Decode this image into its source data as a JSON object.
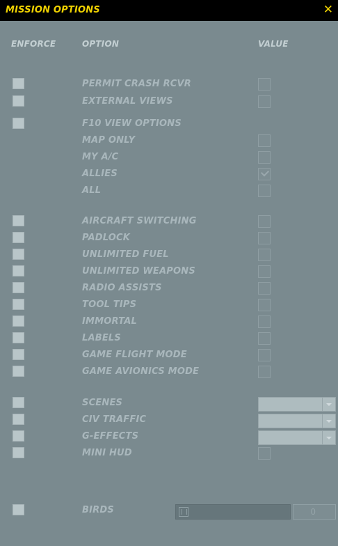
{
  "window": {
    "title": "MISSION OPTIONS",
    "close_glyph": "✕"
  },
  "headers": {
    "enforce": "ENFORCE",
    "option": "OPTION",
    "value": "VALUE"
  },
  "options": {
    "permit_crash_rcvr": "PERMIT CRASH RCVR",
    "external_views": "EXTERNAL VIEWS",
    "f10_view_options": "F10 VIEW OPTIONS",
    "map_only": "MAP ONLY",
    "my_ac": "MY A/C",
    "allies": "ALLIES",
    "all": "ALL",
    "aircraft_switching": "AIRCRAFT SWITCHING",
    "padlock": "PADLOCK",
    "unlimited_fuel": "UNLIMITED FUEL",
    "unlimited_weapons": "UNLIMITED WEAPONS",
    "radio_assists": "RADIO ASSISTS",
    "tool_tips": "TOOL TIPS",
    "immortal": "IMMORTAL",
    "labels": "LABELS",
    "game_flight_mode": "GAME FLIGHT MODE",
    "game_avionics_mode": "GAME AVIONICS MODE",
    "scenes": "SCENES",
    "civ_traffic": "CIV TRAFFIC",
    "g_effects": "G-EFFECTS",
    "mini_hud": "MINI HUD",
    "birds": "BIRDS"
  },
  "values": {
    "allies_checked": true,
    "birds_value": "0"
  },
  "colors": {
    "background": "#7a8a8f",
    "title_accent": "#f0d200"
  }
}
